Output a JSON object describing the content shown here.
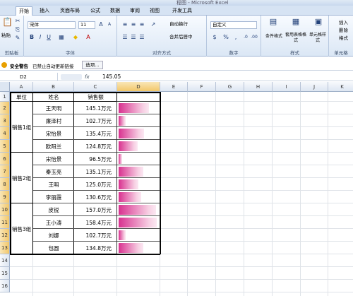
{
  "titlebar": {
    "title": "程图 - Microsoft Excel"
  },
  "tabs": [
    "开始",
    "插入",
    "页面布局",
    "公式",
    "数据",
    "审阅",
    "视图",
    "开发工具"
  ],
  "ribbon": {
    "clipboard": {
      "paste": "粘贴",
      "label": "剪贴板"
    },
    "font": {
      "name": "宋体",
      "size": "11",
      "label": "字体"
    },
    "align": {
      "wrap": "自动换行",
      "merge": "合并后居中",
      "label": "对齐方式"
    },
    "number": {
      "format": "自定义",
      "label": "数字"
    },
    "styles": {
      "cond": "条件格式",
      "table": "套用表格格式",
      "cell": "单元格样式",
      "label": "样式"
    },
    "cells": {
      "insert": "插入",
      "delete": "删除",
      "format": "格式",
      "label": "单元格"
    }
  },
  "security": {
    "title": "安全警告",
    "message": "已禁止自动更新链接",
    "options": "选项..."
  },
  "formula": {
    "namebox": "D2",
    "fx": "fx",
    "value": "145.05"
  },
  "columns": [
    "A",
    "B",
    "C",
    "D",
    "E",
    "F",
    "G",
    "H",
    "I",
    "J",
    "K"
  ],
  "rows": [
    "1",
    "2",
    "3",
    "4",
    "5",
    "6",
    "7",
    "8",
    "9",
    "10",
    "11",
    "12",
    "13",
    "14",
    "15",
    "16"
  ],
  "table": {
    "headers": {
      "unit": "单位",
      "name": "姓名",
      "sales": "销售额"
    },
    "groups": [
      "销售1组",
      "销售2组",
      "销售3组"
    ],
    "records": [
      {
        "name": "王天明",
        "sales": "145.1万元",
        "value": 145.05
      },
      {
        "name": "廉泽村",
        "sales": "102.7万元",
        "value": 102.7
      },
      {
        "name": "宋怡景",
        "sales": "135.4万元",
        "value": 135.4
      },
      {
        "name": "欧阳兰",
        "sales": "124.8万元",
        "value": 124.8
      },
      {
        "name": "宋怡景",
        "sales": "96.5万元",
        "value": 96.5
      },
      {
        "name": "秦玉亮",
        "sales": "135.1万元",
        "value": 135.1
      },
      {
        "name": "王明",
        "sales": "125.0万元",
        "value": 125.0
      },
      {
        "name": "李丽霞",
        "sales": "130.6万元",
        "value": 130.6
      },
      {
        "name": "皮锐",
        "sales": "157.0万元",
        "value": 157.0
      },
      {
        "name": "王小涛",
        "sales": "158.4万元",
        "value": 158.4
      },
      {
        "name": "刘娜",
        "sales": "102.7万元",
        "value": 102.7
      },
      {
        "name": "包圆",
        "sales": "134.8万元",
        "value": 134.8
      }
    ]
  },
  "colors": {
    "bar": "#d8318f",
    "ribbon": "#dbe7f5"
  }
}
